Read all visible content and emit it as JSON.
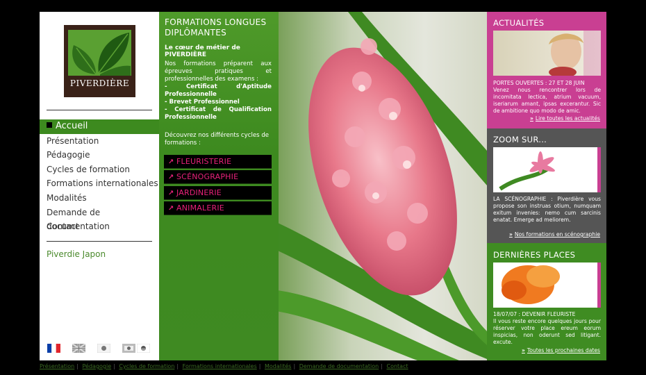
{
  "logo": {
    "brand": "PIVERDIÈRE"
  },
  "menu": [
    {
      "label": "Accueil",
      "active": true
    },
    {
      "label": "Présentation"
    },
    {
      "label": "Pédagogie"
    },
    {
      "label": "Cycles de formation"
    },
    {
      "label": "Formations internationales"
    },
    {
      "label": "Modalités"
    },
    {
      "label": "Demande de documentation"
    },
    {
      "label": "Contact"
    }
  ],
  "japon_link": "Piverdie Japon",
  "languages": [
    "fr-flag-icon",
    "uk-flag-icon",
    "jp-flag-icon",
    "kr-flag-icon"
  ],
  "formations": {
    "title": "FORMATIONS LONGUES DIPLÔMANTES",
    "lead": "Le cœur de métier de PIVERDIÈRE",
    "intro": "Nos formations préparent aux épreuves pratiques et professionnelles des examens :",
    "diplomas": [
      "- Certificat d'Aptitude Professionnelle",
      "- Brevet Professionnel",
      "- Certificat de Qualification Professionnelle"
    ],
    "cycles_text": "Découvrez nos différents cycles de formations :",
    "categories": [
      "FLEURISTERIE",
      "SCÉNOGRAPHIE",
      "JARDINERIE",
      "ANIMALERIE"
    ]
  },
  "actualites": {
    "title": "ACTUALITÉS",
    "headline": "PORTES OUVERTES : 27 ET 28 JUIN",
    "text": "Venez nous rencontrer lors de incomitata lectica, atrium vacuum, iseriarum amant, ipsas excerantur. Sic de ambitione quo modo de amic.",
    "link": "Lire toutes les actualités"
  },
  "zoom": {
    "title": "ZOOM SUR...",
    "text": "LA SCÉNOGRAPHIE : Piverdière vous propose son instruas otium, numquam exitum invenies: nemo cum sarcinis enatat. Emerge ad meliorem.",
    "link": "Nos formations en scénographie"
  },
  "places": {
    "title": "DERNIÈRES PLACES",
    "headline": "18/07/07 : DEVENIR FLEURISTE",
    "text": "Il vous reste encore quelques jours pour réserver votre place ereum eorum inspicias, non oderunt sed litigant. excute.",
    "link": "Toutes les prochaines dates"
  },
  "footer": [
    "Présentation",
    "Pédagogie",
    "Cycles de formation",
    "Formations internationales",
    "Modalités",
    "Demande de documentation",
    "Contact"
  ],
  "colors": {
    "green": "#3d8a1f",
    "pink": "#c93f92",
    "magenta": "#e8217a",
    "grey": "#555555"
  }
}
